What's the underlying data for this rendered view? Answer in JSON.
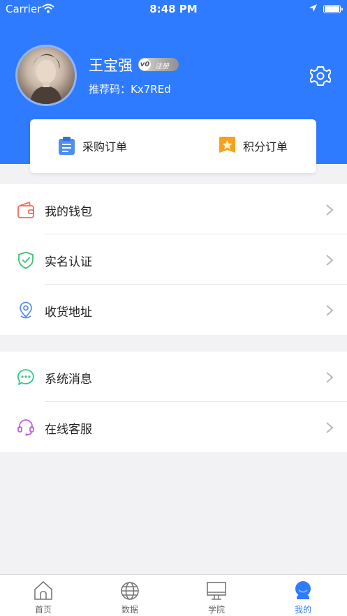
{
  "status_bar": {
    "carrier": "Carrier",
    "time": "8:48 PM"
  },
  "profile": {
    "name": "王宝强",
    "badge_level": "v0",
    "badge_text": "注册",
    "referral_label": "推荐码：",
    "referral_code": "Kx7REd"
  },
  "orders": {
    "purchase_label": "采购订单",
    "points_label": "积分订单"
  },
  "menu_section_1": [
    {
      "label": "我的钱包",
      "icon": "wallet-icon"
    },
    {
      "label": "实名认证",
      "icon": "shield-check-icon"
    },
    {
      "label": "收货地址",
      "icon": "location-icon"
    }
  ],
  "menu_section_2": [
    {
      "label": "系统消息",
      "icon": "chat-bubble-icon"
    },
    {
      "label": "在线客服",
      "icon": "headset-icon"
    }
  ],
  "tabs": [
    {
      "label": "首页",
      "icon": "home-icon"
    },
    {
      "label": "数据",
      "icon": "globe-icon"
    },
    {
      "label": "学院",
      "icon": "monitor-icon"
    },
    {
      "label": "我的",
      "icon": "user-icon",
      "active": true
    }
  ],
  "colors": {
    "primary": "#2f7bff",
    "background": "#f2f2f5"
  }
}
